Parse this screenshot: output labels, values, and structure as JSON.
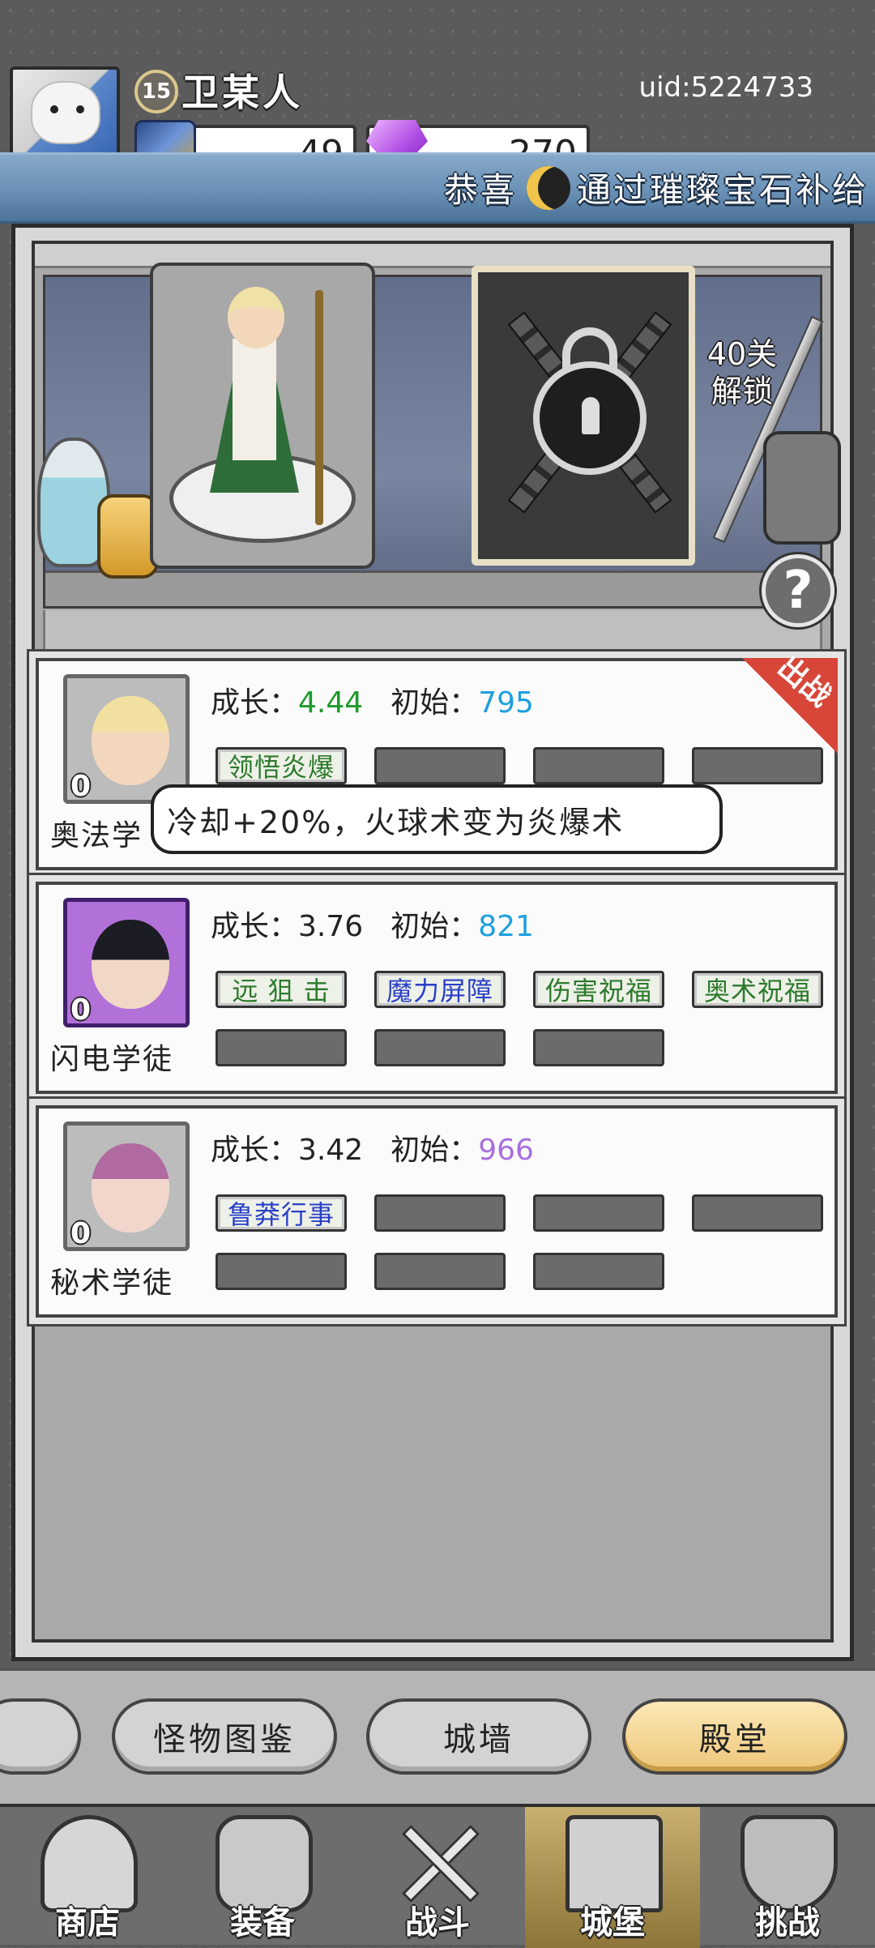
{
  "header": {
    "player_name": "卫某人",
    "level": "15",
    "uid": "uid:5224733",
    "cards_count": "49",
    "gems_count": "270"
  },
  "notice": {
    "text_before": "恭喜",
    "text_after": "通过璀璨宝石补给",
    "icon": "moon-icon"
  },
  "scene": {
    "unlock_text": "40关解锁",
    "help_label": "?"
  },
  "stats": {
    "growth_label": "成长：",
    "initial_label": "初始："
  },
  "mages": [
    {
      "name": "奥法学",
      "level": "0",
      "growth": "4.44",
      "initial": "795",
      "growth_color": "#1f9a2b",
      "initial_color": "#1e9fe0",
      "deployed": "出战",
      "skills": [
        "领悟炎爆"
      ]
    },
    {
      "name": "闪电学徒",
      "level": "0",
      "growth": "3.76",
      "initial": "821",
      "growth_color": "#222222",
      "initial_color": "#1e9fe0",
      "skills": [
        "远 狙 击",
        "魔力屏障",
        "伤害祝福",
        "奥术祝福"
      ]
    },
    {
      "name": "秘术学徒",
      "level": "0",
      "growth": "3.42",
      "initial": "966",
      "growth_color": "#222222",
      "initial_color": "#a86ee0",
      "skills": [
        "鲁莽行事"
      ]
    }
  ],
  "tooltip": {
    "text": "冷却+20%，火球术变为炎爆术"
  },
  "subtabs": [
    "怪物图鉴",
    "城墙",
    "殿堂"
  ],
  "nav": [
    "商店",
    "装备",
    "战斗",
    "城堡",
    "挑战"
  ],
  "colors": {
    "skill_green": "#2c7a2c",
    "skill_blue": "#2a40c8",
    "active_tab": "#eec77a"
  }
}
